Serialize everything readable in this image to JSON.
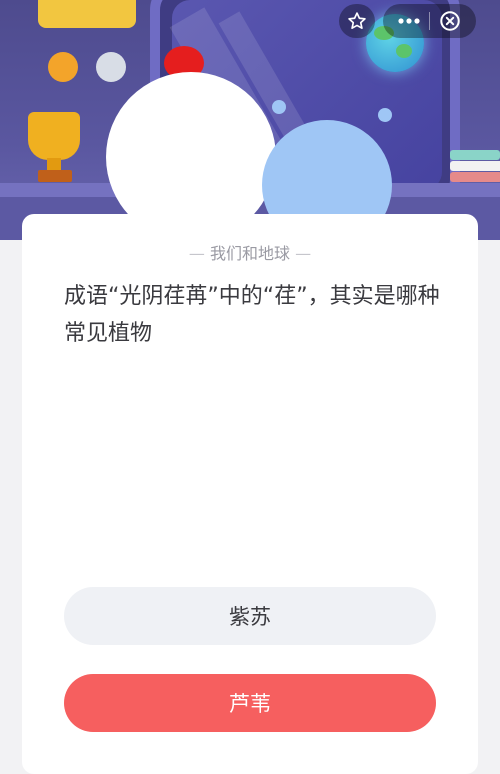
{
  "header": {
    "controls": {
      "favorite_icon": "star-outline-icon",
      "more_icon": "more-dots-icon",
      "close_icon": "close-circle-icon"
    }
  },
  "quiz": {
    "category": "我们和地球",
    "question": "成语“光阴荏苒”中的“荏”，其实是哪种常见植物",
    "options": [
      {
        "label": "紫苏"
      },
      {
        "label": "芦苇"
      }
    ]
  },
  "colors": {
    "scene_bg": "#4e4b8e",
    "option_neutral": "#eff1f5",
    "option_selected": "#f65f5f"
  }
}
